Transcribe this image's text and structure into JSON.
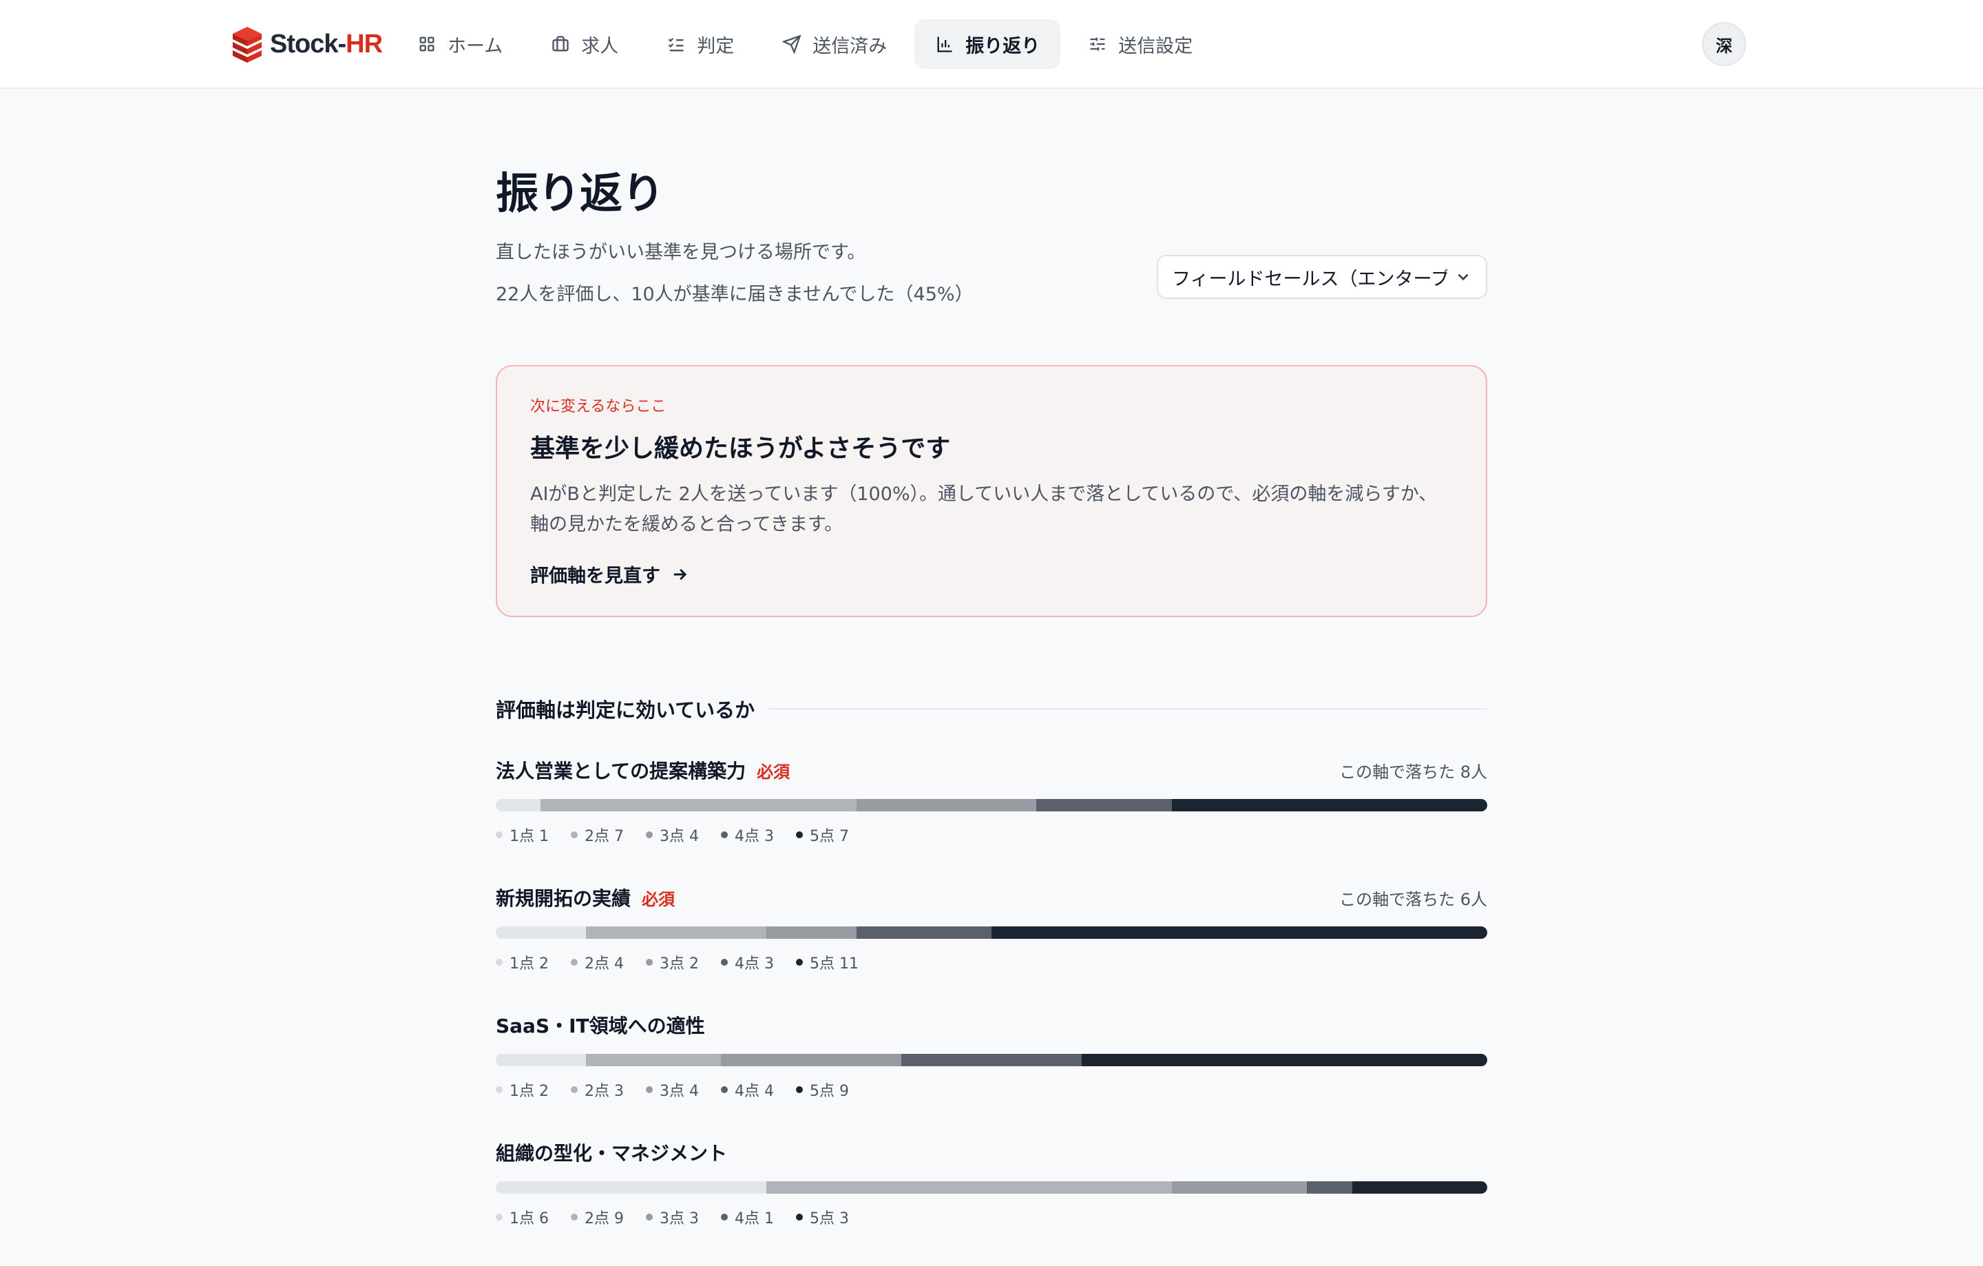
{
  "brand": {
    "stock": "Stock-",
    "hr": "HR"
  },
  "nav": [
    {
      "label": "ホーム",
      "icon": "grid-icon",
      "active": false
    },
    {
      "label": "求人",
      "icon": "briefcase-icon",
      "active": false
    },
    {
      "label": "判定",
      "icon": "checklist-icon",
      "active": false
    },
    {
      "label": "送信済み",
      "icon": "send-icon",
      "active": false
    },
    {
      "label": "振り返り",
      "icon": "bar-chart-icon",
      "active": true
    },
    {
      "label": "送信設定",
      "icon": "sliders-icon",
      "active": false
    }
  ],
  "user": {
    "avatar_text": "深"
  },
  "page": {
    "title": "振り返り",
    "subtitle": "直したほうがいい基準を見つける場所です。",
    "summary": "22人を評価し、10人が基準に届きませんでした（45%）",
    "job_select": "フィールドセールス（エンタープライズ）"
  },
  "alert": {
    "label": "次に変えるならここ",
    "title": "基準を少し緩めたほうがよさそうです",
    "body": "AIがBと判定した 2人を送っています（100%）。通していい人まで落としているので、必須の軸を減らすか、軸の見かたを緩めると合ってきます。",
    "link": "評価軸を見直す",
    "colors": {
      "accent": "#d92d20",
      "background": "#f7f3f3",
      "border": "#f4b4b0"
    }
  },
  "section_title": "評価軸は判定に効いているか",
  "score_colors": [
    "#e2e5e9",
    "#b0b4ba",
    "#979ca3",
    "#5b616b",
    "#1c2331"
  ],
  "axes": [
    {
      "name": "法人営業としての提案構築力",
      "required": "必須",
      "dropped": "この軸で落ちた 8人",
      "counts": [
        1,
        7,
        4,
        3,
        7
      ],
      "legend": [
        "1点 1",
        "2点 7",
        "3点 4",
        "4点 3",
        "5点 7"
      ]
    },
    {
      "name": "新規開拓の実績",
      "required": "必須",
      "dropped": "この軸で落ちた 6人",
      "counts": [
        2,
        4,
        2,
        3,
        11
      ],
      "legend": [
        "1点 2",
        "2点 4",
        "3点 2",
        "4点 3",
        "5点 11"
      ]
    },
    {
      "name": "SaaS・IT領域への適性",
      "required": "",
      "dropped": "",
      "counts": [
        2,
        3,
        4,
        4,
        9
      ],
      "legend": [
        "1点 2",
        "2点 3",
        "3点 4",
        "4点 4",
        "5点 9"
      ]
    },
    {
      "name": "組織の型化・マネジメント",
      "required": "",
      "dropped": "",
      "counts": [
        6,
        9,
        3,
        1,
        3
      ],
      "legend": [
        "1点 6",
        "2点 9",
        "3点 3",
        "4点 1",
        "5点 3"
      ]
    }
  ]
}
